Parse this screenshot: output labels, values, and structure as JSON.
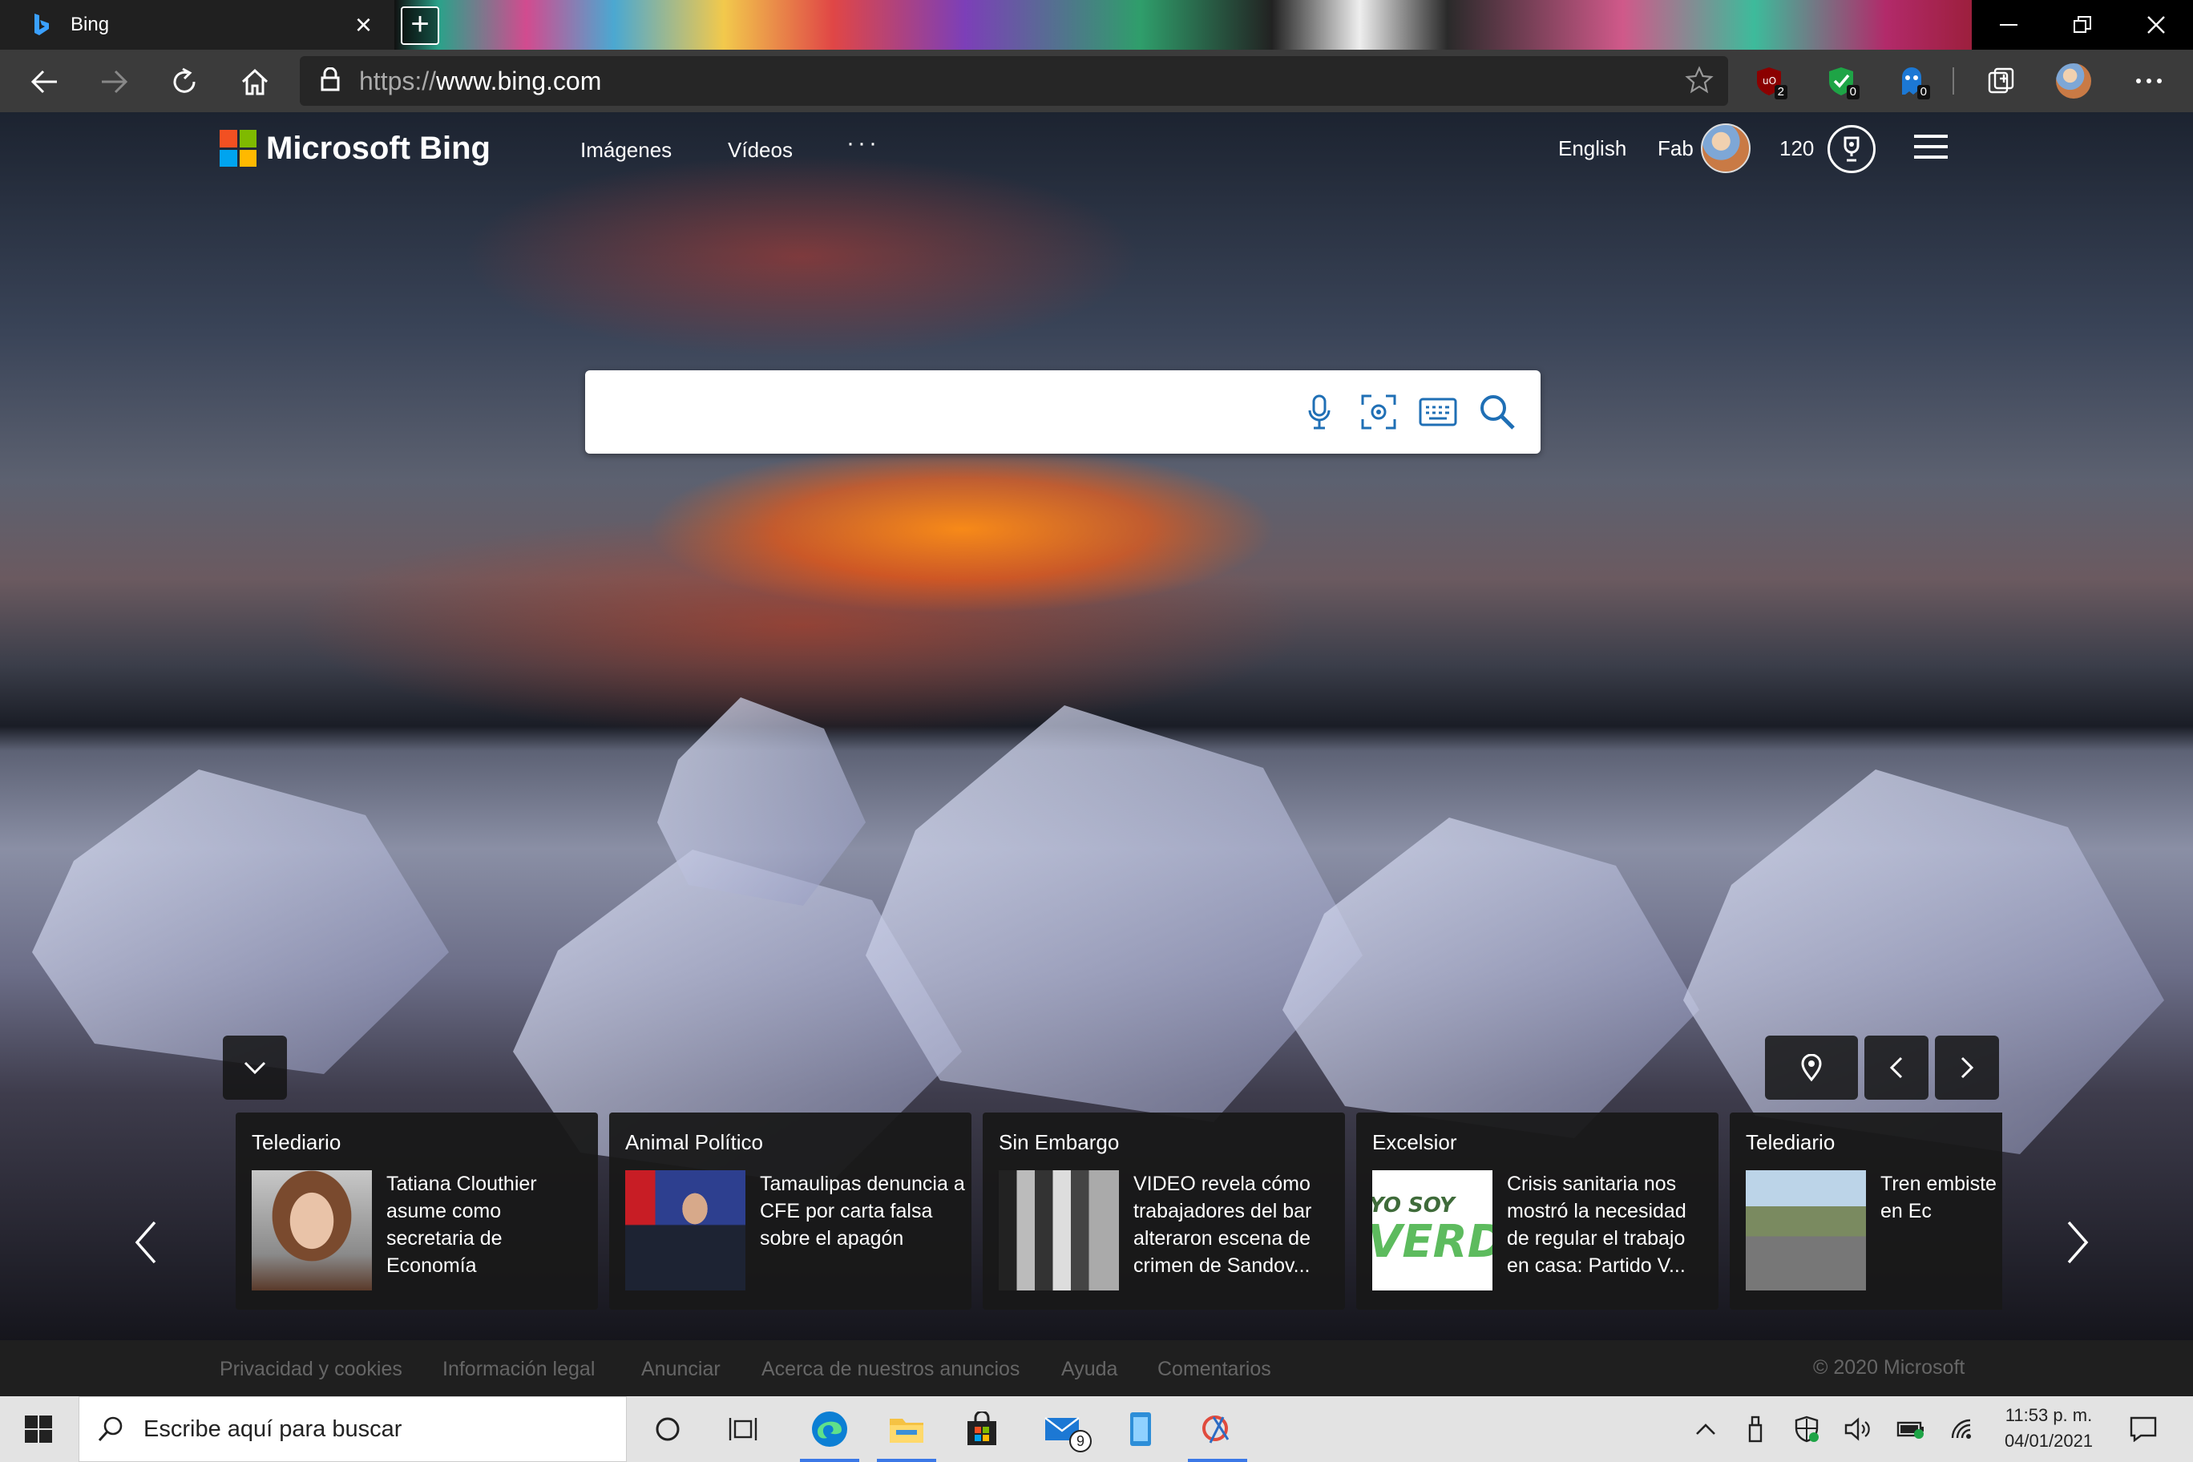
{
  "browser": {
    "tab_title": "Bing",
    "new_tab_label": "+",
    "url_scheme": "https://",
    "url_host": "www.bing.com",
    "extensions": [
      {
        "name": "ublock-icon",
        "badge": "2"
      },
      {
        "name": "shield-check-icon",
        "badge": "0"
      },
      {
        "name": "ghost-icon",
        "badge": "0"
      }
    ]
  },
  "bing": {
    "brand": "Microsoft Bing",
    "nav": [
      "Imágenes",
      "Vídeos"
    ],
    "more": "···",
    "language": "English",
    "user_name": "Fab",
    "points": "120",
    "search_placeholder": ""
  },
  "news": [
    {
      "source": "Telediario",
      "headline": "Tatiana Clouthier asume como secretaria de Economía",
      "thumb": "portrait"
    },
    {
      "source": "Animal Político",
      "headline": "Tamaulipas denuncia a CFE por carta falsa sobre el apagón",
      "thumb": "press"
    },
    {
      "source": "Sin Embargo",
      "headline": "VIDEO revela cómo trabajadores del bar alteraron escena de crimen de Sandov...",
      "thumb": "cctv"
    },
    {
      "source": "Excelsior",
      "headline": "Crisis sanitaria nos mostró la necesidad de regular el trabajo en casa: Partido V...",
      "thumb": "verde",
      "thumb_text_1": "YO SOY",
      "thumb_text_2": "VERDE"
    },
    {
      "source": "Telediario",
      "headline": "Tren embiste patrulla en Ec",
      "thumb": "street"
    }
  ],
  "footer": {
    "links": [
      "Privacidad y cookies",
      "Información legal",
      "Anunciar",
      "Acerca de nuestros anuncios",
      "Ayuda",
      "Comentarios"
    ],
    "copyright": "© 2020 Microsoft"
  },
  "taskbar": {
    "search_placeholder": "Escribe aquí para buscar",
    "mail_badge": "9",
    "time": "11:53 p. m.",
    "date": "04/01/2021"
  },
  "colors": {
    "accent": "#1f6fb5",
    "taskbar_active": "#3b78e7"
  }
}
